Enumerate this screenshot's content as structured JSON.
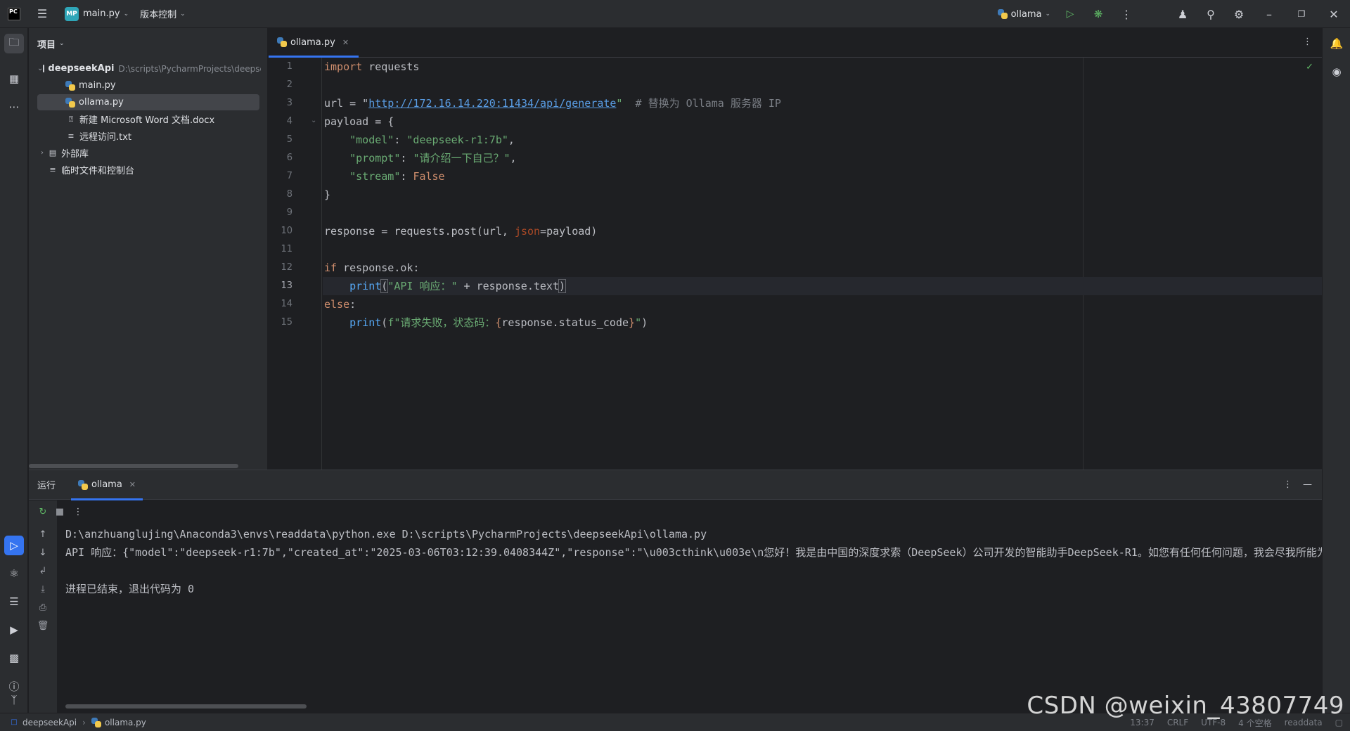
{
  "titlebar": {
    "project_badge": "MP",
    "project_name": "main.py",
    "vcs_label": "版本控制",
    "run_config": "ollama"
  },
  "project_panel": {
    "header": "项目",
    "root_name": "deepseekApi",
    "root_path": "D:\\scripts\\PycharmProjects\\deepseekApi",
    "files": [
      "main.py",
      "ollama.py",
      "新建 Microsoft Word 文档.docx",
      "远程访问.txt"
    ],
    "external_libs": "外部库",
    "scratches": "临时文件和控制台"
  },
  "editor": {
    "tab_label": "ollama.py",
    "line_numbers": [
      "1",
      "2",
      "3",
      "4",
      "5",
      "6",
      "7",
      "8",
      "9",
      "10",
      "11",
      "12",
      "13",
      "14",
      "15"
    ],
    "code": {
      "l1_kw": "import",
      "l1_rest": " requests",
      "l3_pre": "url = \"",
      "l3_url": "http://172.16.14.220:11434/api/generate",
      "l3_post": "\"",
      "l3_comment": "  # 替换为 Ollama 服务器 IP",
      "l4": "payload = {",
      "l5_key": "    \"model\"",
      "l5_sep": ": ",
      "l5_val": "\"deepseek-r1:7b\"",
      "l5_end": ",",
      "l6_key": "    \"prompt\"",
      "l6_sep": ": ",
      "l6_val": "\"请介绍一下自己？\"",
      "l6_end": ",",
      "l7_key": "    \"stream\"",
      "l7_sep": ": ",
      "l7_val": "False",
      "l8": "}",
      "l10_pre": "response = requests.post(url, ",
      "l10_param": "json",
      "l10_post": "=payload)",
      "l12_kw": "if",
      "l12_rest": " response.ok:",
      "l13_indent": "    ",
      "l13_fn": "print",
      "l13_open": "(",
      "l13_str": "\"API 响应：\"",
      "l13_rest": " + response.text",
      "l13_close": ")",
      "l14_kw": "else",
      "l14_rest": ":",
      "l15_indent": "    ",
      "l15_fn": "print",
      "l15_open": "(",
      "l15_str": "f\"请求失败，状态码：",
      "l15_brace1": "{",
      "l15_expr": "response.status_code",
      "l15_brace2": "}",
      "l15_strend": "\"",
      "l15_close": ")"
    }
  },
  "run_panel": {
    "label": "运行",
    "tab_label": "ollama",
    "console_lines": [
      "D:\\anzhuanglujing\\Anaconda3\\envs\\readdata\\python.exe D:\\scripts\\PycharmProjects\\deepseekApi\\ollama.py",
      "API 响应：{\"model\":\"deepseek-r1:7b\",\"created_at\":\"2025-03-06T03:12:39.0408344Z\",\"response\":\"\\u003cthink\\u003e\\n您好！我是由中国的深度求索（DeepSeek）公司开发的智能助手DeepSeek-R1。如您有任何任何问题，我会尽我所能为",
      "",
      "进程已结束，退出代码为 0"
    ]
  },
  "statusbar": {
    "crumb_project": "deepseekApi",
    "crumb_file": "ollama.py",
    "position": "13:37",
    "line_sep": "CRLF",
    "encoding": "UTF-8",
    "indent": "4 个空格",
    "interpreter": "readdata"
  },
  "watermark": "CSDN @weixin_43807749",
  "colors": {
    "accent": "#3574f0",
    "keyword": "#cf8e6d",
    "string": "#6aab73",
    "function": "#56a8f5",
    "comment": "#7a7e85"
  }
}
